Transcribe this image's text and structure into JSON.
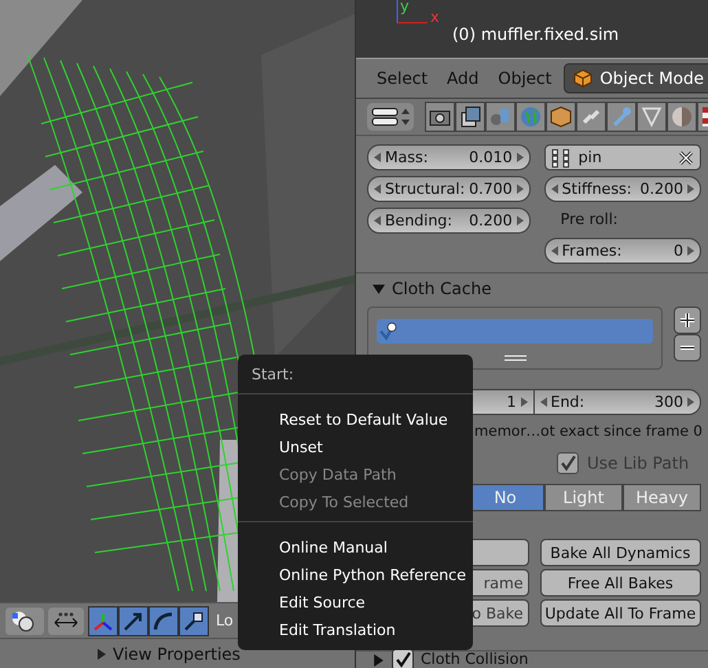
{
  "viewport": {
    "axis_labels": [
      "y",
      "x"
    ],
    "object_label": "(0) muffler.fixed.sim"
  },
  "header": {
    "menus": [
      {
        "label": "Select"
      },
      {
        "label": "Add"
      },
      {
        "label": "Object"
      }
    ],
    "mode": "Object Mode"
  },
  "cloth": {
    "left_fields": [
      {
        "label": "Mass:",
        "value": "0.010"
      },
      {
        "label": "Structural:",
        "value": "0.700"
      },
      {
        "label": "Bending:",
        "value": "0.200"
      }
    ],
    "pin_group": "pin",
    "stiffness": {
      "label": "Stiffness:",
      "value": "0.200"
    },
    "pre_roll_label": "Pre roll:",
    "frames": {
      "label": "Frames:",
      "value": "0"
    }
  },
  "cloth_cache": {
    "title": "Cloth Cache",
    "expanded": true,
    "cache_items": [
      {
        "selected": true
      }
    ],
    "start": {
      "value": "1"
    },
    "end": {
      "label": "End:",
      "value": "300"
    },
    "info": "memor…ot exact since frame 0",
    "checks": [
      {
        "label": "Use Lib Path",
        "checked": true,
        "disabled": true
      }
    ],
    "compression": [
      {
        "label": "No",
        "selected": true
      },
      {
        "label": "Light",
        "selected": false
      },
      {
        "label": "Heavy",
        "selected": false
      }
    ],
    "buttons": [
      {
        "disabled": true
      },
      {
        "label": "Bake All Dynamics",
        "disabled": false
      },
      {
        "label": "rame",
        "disabled": true
      },
      {
        "label": "Free All Bakes",
        "disabled": false
      },
      {
        "label": "o Bake",
        "disabled": true
      },
      {
        "label": "Update All To Frame",
        "disabled": false
      }
    ]
  },
  "cloth_collision": {
    "title": "Cloth Collision",
    "expanded": false,
    "checked": true
  },
  "view_header": {
    "orientation": "Lo"
  },
  "view_properties": {
    "title": "View Properties",
    "expanded": false
  },
  "context_menu": {
    "title": "Start:",
    "groups": [
      [
        {
          "label": "Reset to Default Value",
          "disabled": false
        },
        {
          "label": "Unset",
          "disabled": false
        },
        {
          "label": "Copy Data Path",
          "disabled": true
        },
        {
          "label": "Copy To Selected",
          "disabled": true
        }
      ],
      [
        {
          "label": "Online Manual",
          "disabled": false
        },
        {
          "label": "Online Python Reference",
          "disabled": false
        },
        {
          "label": "Edit Source",
          "disabled": false
        },
        {
          "label": "Edit Translation",
          "disabled": false
        }
      ]
    ]
  }
}
